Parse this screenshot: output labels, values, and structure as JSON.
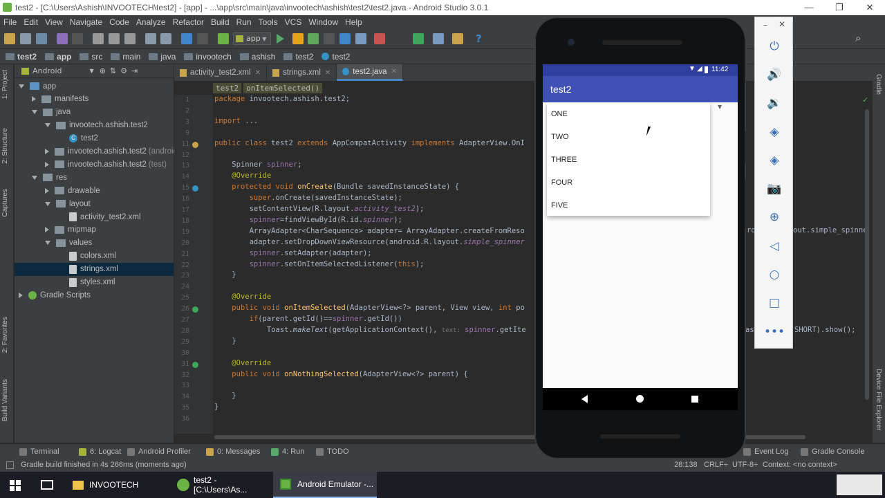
{
  "window": {
    "title": "test2 - [C:\\Users\\Ashish\\INVOOTECH\\test2] - [app] - ...\\app\\src\\main\\java\\invootech\\ashish\\test2\\test2.java - Android Studio 3.0.1"
  },
  "menu": [
    "File",
    "Edit",
    "View",
    "Navigate",
    "Code",
    "Analyze",
    "Refactor",
    "Build",
    "Run",
    "Tools",
    "VCS",
    "Window",
    "Help"
  ],
  "toolbar": {
    "run_config": "app"
  },
  "breadcrumb": [
    "test2",
    "app",
    "src",
    "main",
    "java",
    "invootech",
    "ashish",
    "test2",
    "test2"
  ],
  "project_panel": {
    "view_mode": "Android",
    "tree": [
      {
        "label": "app",
        "indent": 0,
        "open": true,
        "type": "folder-blue"
      },
      {
        "label": "manifests",
        "indent": 1,
        "open": false,
        "type": "folder"
      },
      {
        "label": "java",
        "indent": 1,
        "open": true,
        "type": "folder"
      },
      {
        "label": "invootech.ashish.test2",
        "indent": 2,
        "open": true,
        "type": "folder"
      },
      {
        "label": "test2",
        "indent": 3,
        "type": "class"
      },
      {
        "label": "invootech.ashish.test2",
        "suffix": "(android",
        "indent": 2,
        "open": false,
        "type": "folder"
      },
      {
        "label": "invootech.ashish.test2",
        "suffix": "(test)",
        "indent": 2,
        "open": false,
        "type": "folder"
      },
      {
        "label": "res",
        "indent": 1,
        "open": true,
        "type": "folder"
      },
      {
        "label": "drawable",
        "indent": 2,
        "open": false,
        "type": "folder"
      },
      {
        "label": "layout",
        "indent": 2,
        "open": true,
        "type": "folder"
      },
      {
        "label": "activity_test2.xml",
        "indent": 3,
        "type": "file"
      },
      {
        "label": "mipmap",
        "indent": 2,
        "open": false,
        "type": "folder"
      },
      {
        "label": "values",
        "indent": 2,
        "open": true,
        "type": "folder"
      },
      {
        "label": "colors.xml",
        "indent": 3,
        "type": "file"
      },
      {
        "label": "strings.xml",
        "indent": 3,
        "type": "file",
        "selected": true
      },
      {
        "label": "styles.xml",
        "indent": 3,
        "type": "file"
      },
      {
        "label": "Gradle Scripts",
        "indent": 0,
        "open": false,
        "type": "gradle"
      }
    ]
  },
  "left_tool_tabs": [
    "1: Project",
    "2: Structure",
    "Captures",
    "2: Favorites",
    "Build Variants"
  ],
  "right_tool_tabs": [
    "Gradle",
    "Device File Explorer"
  ],
  "editor": {
    "tabs": [
      {
        "label": "activity_test2.xml",
        "active": false
      },
      {
        "label": "strings.xml",
        "active": false
      },
      {
        "label": "test2.java",
        "active": true
      }
    ],
    "crumbs": [
      "test2",
      "onItemSelected()"
    ],
    "lines": [
      {
        "n": "1",
        "html": "<span class='kw'>package</span> invootech.ashish.test2;"
      },
      {
        "n": "2",
        "html": ""
      },
      {
        "n": "3",
        "html": "<span class='kw'>import</span> ..."
      },
      {
        "n": "9",
        "html": ""
      },
      {
        "n": "11",
        "html": "<span class='kw'>public class</span> test2 <span class='kw'>extends</span> AppCompatActivity <span class='kw'>implements</span> AdapterView.OnI"
      },
      {
        "n": "12",
        "html": ""
      },
      {
        "n": "13",
        "html": "    Spinner <span class='fd'>spinner</span>;"
      },
      {
        "n": "14",
        "html": "    <span class='an'>@Override</span>"
      },
      {
        "n": "15",
        "html": "    <span class='kw'>protected void</span> <span class='fn'>onCreate</span>(Bundle savedInstanceState) {"
      },
      {
        "n": "16",
        "html": "        <span class='kw'>super</span>.onCreate(savedInstanceState);"
      },
      {
        "n": "17",
        "html": "        setContentView(R.layout.<span class='fd it'>activity_test2</span>);"
      },
      {
        "n": "18",
        "html": "        <span class='fd'>spinner</span>=findViewById(R.id.<span class='fd it'>spinner</span>);"
      },
      {
        "n": "19",
        "html": "        ArrayAdapter&lt;CharSequence&gt; adapter= ArrayAdapter.createFromReso"
      },
      {
        "n": "20",
        "html": "        adapter.setDropDownViewResource(android.R.layout.<span class='fd it'>simple_spinner</span>"
      },
      {
        "n": "21",
        "html": "        <span class='fd'>spinner</span>.setAdapter(adapter);"
      },
      {
        "n": "22",
        "html": "        <span class='fd'>spinner</span>.setOnItemSelectedListener(<span class='kw'>this</span>);"
      },
      {
        "n": "23",
        "html": "    }"
      },
      {
        "n": "24",
        "html": ""
      },
      {
        "n": "25",
        "html": "    <span class='an'>@Override</span>"
      },
      {
        "n": "26",
        "html": "    <span class='kw'>public void</span> <span class='fn'>onItemSelected</span>(AdapterView&lt;?&gt; parent, View view, <span class='kw'>int</span> po"
      },
      {
        "n": "27",
        "html": "        <span class='kw'>if</span>(parent.getId()==<span class='fd'>spinner</span>.getId())"
      },
      {
        "n": "28",
        "html": "            Toast.<span class='it'>makeText</span>(getApplicationContext(), <span style='color:#787878;font-size:9px'>text:</span> <span class='fd'>spinner</span>.getIte"
      },
      {
        "n": "29",
        "html": "    }"
      },
      {
        "n": "30",
        "html": ""
      },
      {
        "n": "31",
        "html": "    <span class='an'>@Override</span>"
      },
      {
        "n": "32",
        "html": "    <span class='kw'>public void</span> <span class='fn'>onNothingSelected</span>(AdapterView&lt;?&gt; parent) {"
      },
      {
        "n": "33",
        "html": ""
      },
      {
        "n": "34",
        "html": "    }"
      },
      {
        "n": "35",
        "html": "}"
      },
      {
        "n": "36",
        "html": ""
      }
    ],
    "overflow_right_1": "ro",
    "overflow_right_2": "out.simple_spinne",
    "overflow_right_3": "as",
    "overflow_right_4": "SHORT).show();"
  },
  "bottom_tools": [
    "Terminal",
    "6: Logcat",
    "Android Profiler",
    "0: Messages",
    "4: Run",
    "TODO",
    "Event Log",
    "Gradle Console"
  ],
  "status": {
    "message": "Gradle build finished in 4s 266ms (moments ago)",
    "position": "28:138",
    "line_sep": "CRLF÷",
    "encoding": "UTF-8÷",
    "context": "Context: <no context>"
  },
  "taskbar": {
    "items": [
      "INVOOTECH",
      "test2 - [C:\\Users\\As...",
      "Android Emulator -..."
    ]
  },
  "emulator": {
    "status_time": "11:42",
    "app_title": "test2",
    "spinner_items": [
      "ONE",
      "TWO",
      "THREE",
      "FOUR",
      "FIVE"
    ]
  },
  "colors": {
    "accent": "#3f51b5",
    "status_bar": "#303f9f",
    "ide_bg": "#2b2b2b",
    "ide_panel": "#3c3f41"
  }
}
